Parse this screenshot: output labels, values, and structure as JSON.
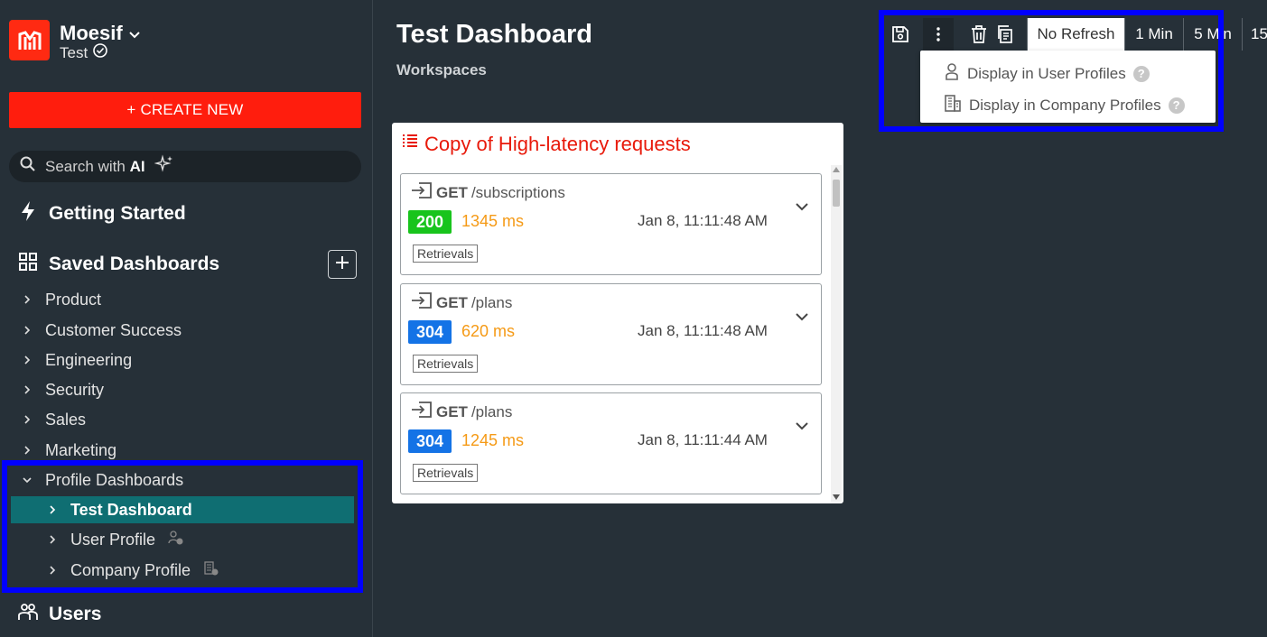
{
  "brand": {
    "name": "Moesif",
    "env": "Test"
  },
  "sidebar": {
    "create_label": "+ CREATE NEW",
    "search_prefix": "Search with",
    "search_ai": "AI",
    "getting_started": "Getting Started",
    "saved_dashboards": "Saved Dashboards",
    "folders": [
      "Product",
      "Customer Success",
      "Engineering",
      "Security",
      "Sales",
      "Marketing"
    ],
    "profile_dashboards": "Profile Dashboards",
    "profile_items": [
      "Test Dashboard",
      "User Profile",
      "Company Profile"
    ],
    "users": "Users"
  },
  "main": {
    "title": "Test Dashboard",
    "breadcrumb": "Workspaces",
    "card_title": "Copy of High-latency requests",
    "events": [
      {
        "method": "GET",
        "path": "/subscriptions",
        "status": "200",
        "status_color": "#18c41c",
        "latency": "1345 ms",
        "time": "Jan 8, 11:11:48 AM",
        "tag": "Retrievals"
      },
      {
        "method": "GET",
        "path": "/plans",
        "status": "304",
        "status_color": "#1473e6",
        "latency": "620 ms",
        "time": "Jan 8, 11:11:48 AM",
        "tag": "Retrievals"
      },
      {
        "method": "GET",
        "path": "/plans",
        "status": "304",
        "status_color": "#1473e6",
        "latency": "1245 ms",
        "time": "Jan 8, 11:11:44 AM",
        "tag": "Retrievals"
      }
    ]
  },
  "toolbar": {
    "refresh_options": [
      "No Refresh",
      "1 Min",
      "5 Min",
      "15"
    ],
    "menu": [
      "Display in User Profiles",
      "Display in Company Profiles"
    ]
  },
  "colors": {
    "accent": "#ff1d0d",
    "active": "#0f6e72",
    "highlight": "#0000ff"
  }
}
